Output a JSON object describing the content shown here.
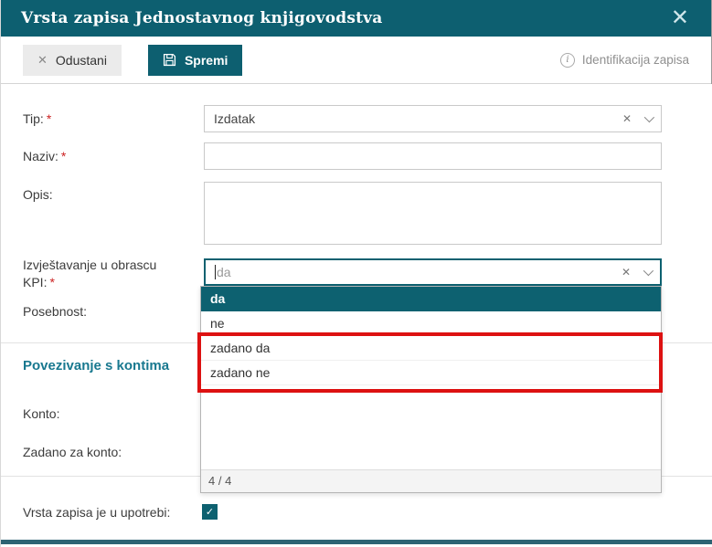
{
  "header": {
    "title": "Vrsta zapisa Jednostavnog knjigovodstva",
    "close_icon": "✕"
  },
  "toolbar": {
    "cancel": {
      "label": "Odustani",
      "icon": "✕"
    },
    "save": {
      "label": "Spremi"
    },
    "identification": {
      "label": "Identifikacija zapisa",
      "icon": "i"
    }
  },
  "form": {
    "tip": {
      "label": "Tip:",
      "required": "*",
      "value": "Izdatak",
      "clear_icon": "✕"
    },
    "naziv": {
      "label": "Naziv:",
      "required": "*",
      "value": ""
    },
    "opis": {
      "label": "Opis:",
      "value": ""
    },
    "kpi": {
      "label": "Izvještavanje u obrascu KPI:",
      "required": "*",
      "placeholder": "da",
      "clear_icon": "✕"
    },
    "posebnost": {
      "label": "Posebnost:"
    },
    "section": {
      "title": "Povezivanje s kontima"
    },
    "konto": {
      "label": "Konto:"
    },
    "zadano_za_konto": {
      "label": "Zadano za konto:"
    },
    "in_use": {
      "label": "Vrsta zapisa je u upotrebi:",
      "checked": true,
      "check_icon": "✓"
    }
  },
  "dropdown": {
    "options": [
      {
        "label": "da",
        "highlighted": true
      },
      {
        "label": "ne",
        "highlighted": false
      },
      {
        "label": "zadano da",
        "highlighted": false,
        "annotated": true
      },
      {
        "label": "zadano ne",
        "highlighted": false,
        "annotated": true
      }
    ],
    "counter": "4 / 4"
  },
  "colors": {
    "accent": "#0d5f70",
    "section_title": "#18788f",
    "required": "#cc2222",
    "annotation_red": "#dd1111"
  }
}
